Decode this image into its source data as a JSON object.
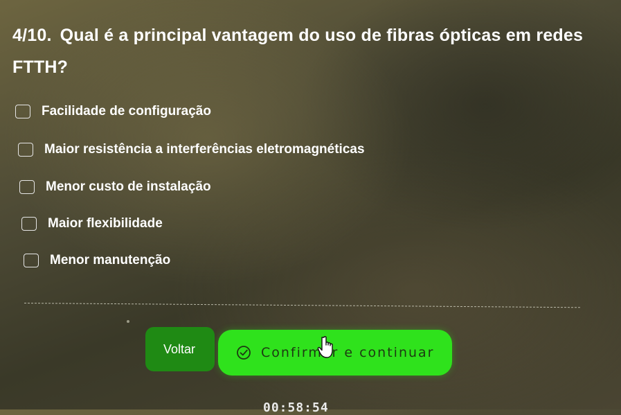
{
  "question": {
    "number": "4/10.",
    "text": "Qual é a principal vantagem do uso de fibras ópticas em redes FTTH?"
  },
  "options": [
    {
      "label": "Facilidade de configuração",
      "checked": false
    },
    {
      "label": "Maior resistência a interferências eletromagnéticas",
      "checked": false
    },
    {
      "label": "Menor custo de instalação",
      "checked": false
    },
    {
      "label": "Maior flexibilidade",
      "checked": false
    },
    {
      "label": "Menor manutenção",
      "checked": false
    }
  ],
  "buttons": {
    "back_label": "Voltar",
    "confirm_label": "Confirmar e continuar",
    "confirm_icon": "check-circle-icon"
  },
  "timer": "00:58:54",
  "colors": {
    "confirm_bg": "#2fe21c",
    "back_bg": "#1f8a14",
    "text": "#ffffff"
  }
}
